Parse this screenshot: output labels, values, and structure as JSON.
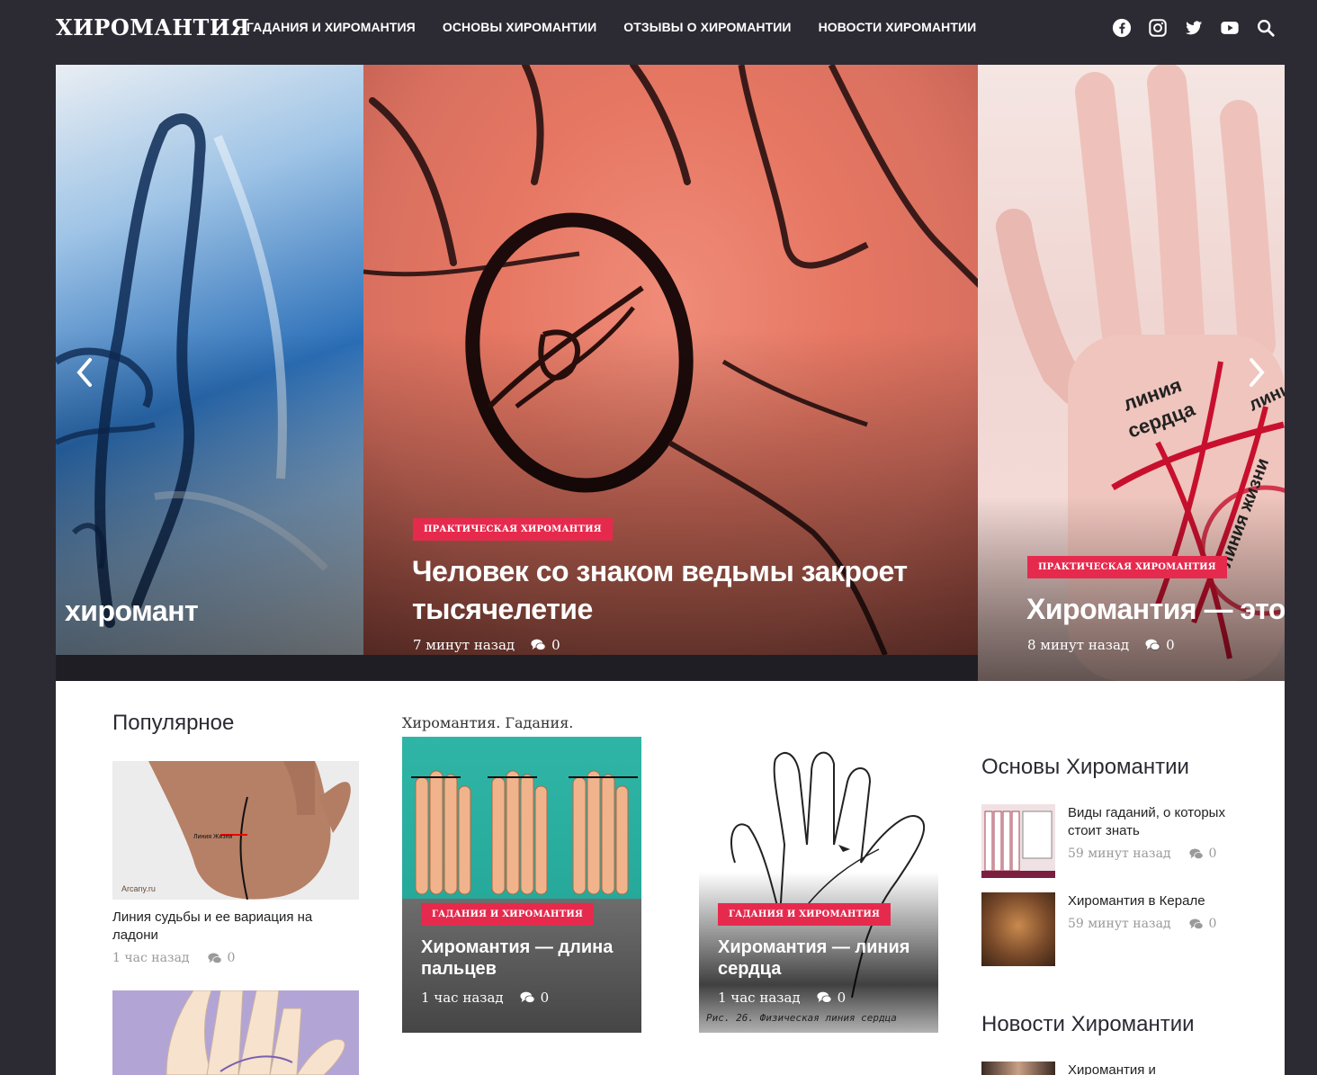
{
  "header": {
    "logo": "ХИРОМАНТИЯ",
    "nav": [
      {
        "label": "ГАДАНИЯ И ХИРОМАНТИЯ"
      },
      {
        "label": "ОСНОВЫ ХИРОМАНТИИ"
      },
      {
        "label": "ОТЗЫВЫ О ХИРОМАНТИИ"
      },
      {
        "label": "НОВОСТИ ХИРОМАНТИИ"
      }
    ],
    "social_icons": [
      "facebook-icon",
      "instagram-icon",
      "twitter-icon",
      "youtube-icon",
      "search-icon"
    ]
  },
  "slider": {
    "left": {
      "title": "хиромант"
    },
    "center": {
      "category": "ПРАКТИЧЕСКАЯ ХИРОМАНТИЯ",
      "title": "Человек со знаком ведьмы закроет тысячелетие",
      "time": "7 минут назад",
      "comments": "0"
    },
    "right": {
      "category": "ПРАКТИЧЕСКАЯ ХИРОМАНТИЯ",
      "title": "Хиромантия — это к",
      "time": "8 минут назад",
      "comments": "0",
      "image_text_1": "линия",
      "image_text_2": "сердца",
      "image_text_3": "лини",
      "image_text_4": "линия жизни"
    }
  },
  "popular": {
    "heading": "Популярное",
    "items": [
      {
        "title": "Линия судьбы и ее вариация на ладони",
        "time": "1 час назад",
        "comments": "0",
        "image_caption": "Линия Жизни",
        "image_watermark": "Arcany.ru"
      }
    ]
  },
  "center_widget": {
    "heading": "Хиромантия. Гадания.",
    "cards": [
      {
        "category": "ГАДАНИЯ И ХИРОМАНТИЯ",
        "title": "Хиромантия — длина пальцев",
        "time": "1 час назад",
        "comments": "0"
      },
      {
        "category": "ГАДАНИЯ И ХИРОМАНТИЯ",
        "title": "Хиромантия — линия сердца",
        "time": "1 час назад",
        "comments": "0",
        "image_caption": "Рис. 26. Физическая линия сердца"
      }
    ]
  },
  "sidebar": {
    "osnovy": {
      "heading": "Основы Хиромантии",
      "items": [
        {
          "title": "Виды гаданий, о которых стоит знать",
          "time": "59 минут назад",
          "comments": "0"
        },
        {
          "title": "Хиромантия в Керале",
          "time": "59 минут назад",
          "comments": "0"
        }
      ]
    },
    "novosti": {
      "heading": "Новости Хиромантии",
      "items": [
        {
          "title": "Хиромантия и"
        }
      ]
    }
  },
  "colors": {
    "background": "#2c2b34",
    "accent": "#e62a4d",
    "content_bg": "#ffffff"
  }
}
